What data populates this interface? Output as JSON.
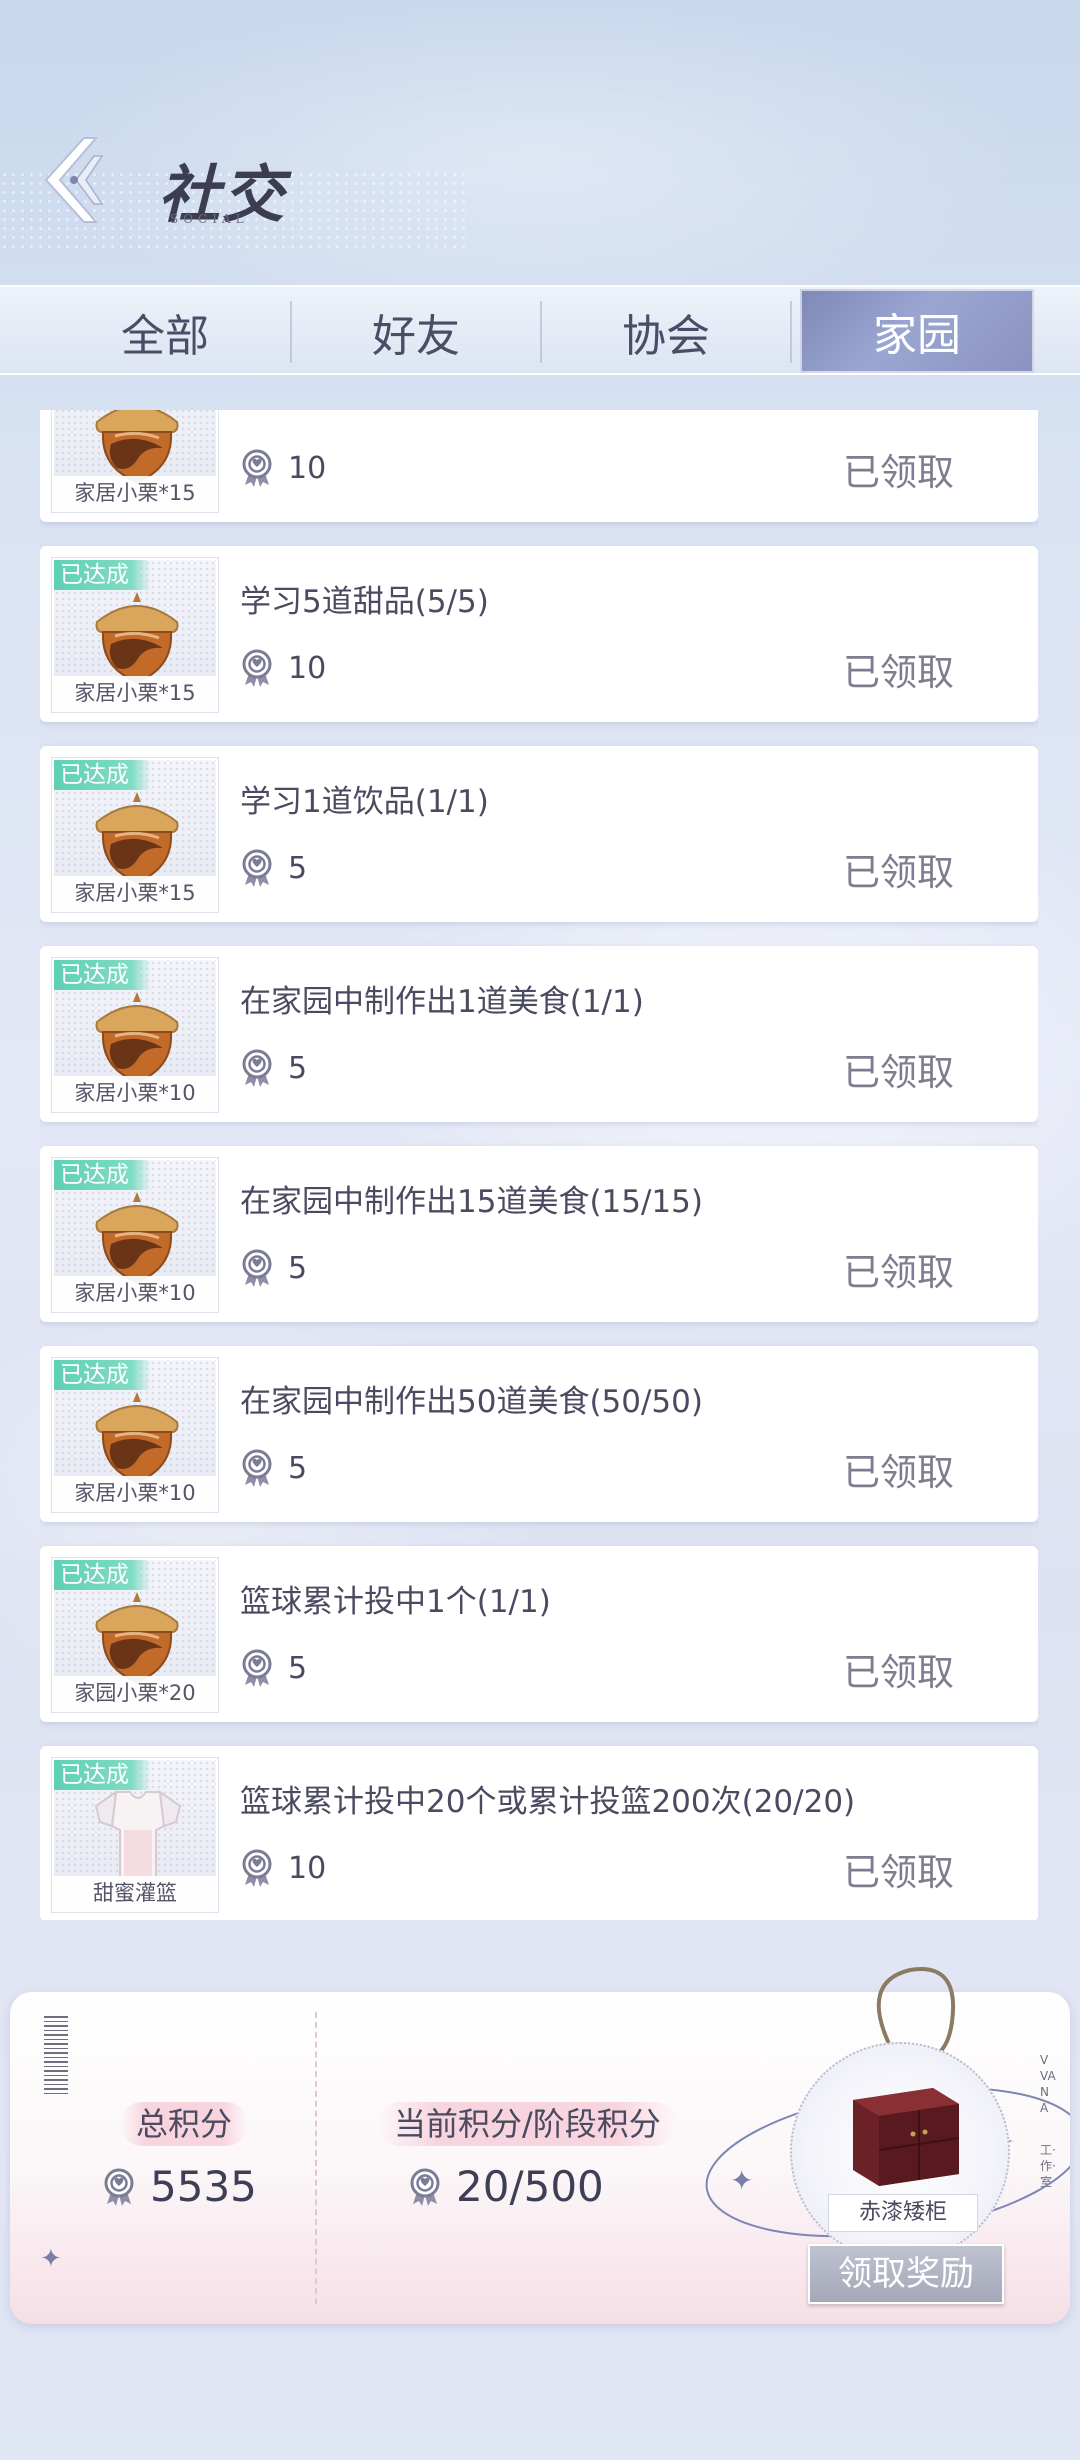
{
  "header": {
    "title": "社交",
    "subtitle": "SOCIAL"
  },
  "tabs": [
    {
      "label": "全部",
      "active": false
    },
    {
      "label": "好友",
      "active": false
    },
    {
      "label": "协会",
      "active": false
    },
    {
      "label": "家园",
      "active": true
    }
  ],
  "tasks": [
    {
      "title": "",
      "points": "10",
      "status": "已领取",
      "badge": "",
      "reward_label": "家居小栗*15",
      "reward_icon": "acorn-icon"
    },
    {
      "title": "学习5道甜品(5/5)",
      "points": "10",
      "status": "已领取",
      "badge": "已达成",
      "reward_label": "家居小栗*15",
      "reward_icon": "acorn-icon"
    },
    {
      "title": "学习1道饮品(1/1)",
      "points": "5",
      "status": "已领取",
      "badge": "已达成",
      "reward_label": "家居小栗*15",
      "reward_icon": "acorn-icon"
    },
    {
      "title": "在家园中制作出1道美食(1/1)",
      "points": "5",
      "status": "已领取",
      "badge": "已达成",
      "reward_label": "家居小栗*10",
      "reward_icon": "acorn-icon"
    },
    {
      "title": "在家园中制作出15道美食(15/15)",
      "points": "5",
      "status": "已领取",
      "badge": "已达成",
      "reward_label": "家居小栗*10",
      "reward_icon": "acorn-icon"
    },
    {
      "title": "在家园中制作出50道美食(50/50)",
      "points": "5",
      "status": "已领取",
      "badge": "已达成",
      "reward_label": "家居小栗*10",
      "reward_icon": "acorn-icon"
    },
    {
      "title": "篮球累计投中1个(1/1)",
      "points": "5",
      "status": "已领取",
      "badge": "已达成",
      "reward_label": "家园小栗*20",
      "reward_icon": "acorn-icon"
    },
    {
      "title": "篮球累计投中20个或累计投篮200次(20/20)",
      "points": "10",
      "status": "已领取",
      "badge": "已达成",
      "reward_label": "甜蜜灌篮",
      "reward_icon": "jersey-icon"
    }
  ],
  "summary": {
    "total_label": "总积分",
    "total_value": "5535",
    "current_label": "当前积分/阶段积分",
    "current_value": "20/500",
    "reward_label": "赤漆矮柜",
    "claim_label": "领取奖励",
    "side_text": "VVANA",
    "side_text_2": "工·作·室"
  },
  "colors": {
    "badge": "#6fd6bc",
    "active_tab": "#8a94c4",
    "claimed_text": "#7d7d90"
  }
}
